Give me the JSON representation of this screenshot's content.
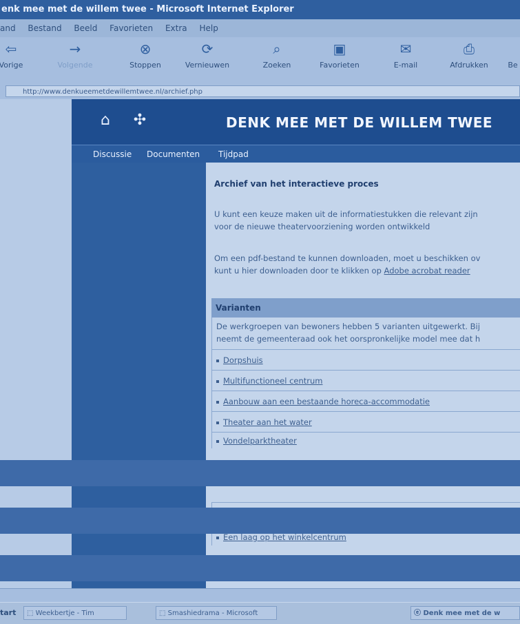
{
  "window": {
    "title": "enk mee met de willem twee - Microsoft Internet Explorer"
  },
  "menu": [
    "and",
    "Bestand",
    "Beeld",
    "Favorieten",
    "Extra",
    "Help"
  ],
  "toolbar": [
    {
      "label": "Vorige",
      "icon": "back-arrow-icon"
    },
    {
      "label": "Volgende",
      "icon": "forward-arrow-icon"
    },
    {
      "label": "Stoppen",
      "icon": "stop-icon"
    },
    {
      "label": "Vernieuwen",
      "icon": "refresh-icon"
    },
    {
      "label": "Zoeken",
      "icon": "search-icon"
    },
    {
      "label": "Favorieten",
      "icon": "favorites-icon"
    },
    {
      "label": "E-mail",
      "icon": "mail-icon"
    },
    {
      "label": "Afdrukken",
      "icon": "print-icon"
    },
    {
      "label": "Be",
      "icon": "edit-icon"
    }
  ],
  "address": {
    "url": "http://www.denkueemetdewillemtwee.nl/archief.php"
  },
  "site": {
    "title": "DENK MEE MET DE WILLEM TWEE"
  },
  "nav": [
    "Discussie",
    "Documenten",
    "Tijdpad"
  ],
  "content": {
    "heading": "Archief van het interactieve proces",
    "p1_line1": "U kunt een keuze maken uit de informatiestukken die relevant zijn",
    "p1_line2": "voor de nieuwe theatervoorziening worden ontwikkeld",
    "p2_line1": "Om een pdf-bestand te kunnen downloaden, moet u beschikken ov",
    "p2_line2_pre": "kunt u hier downloaden door te klikken op ",
    "p2_link": "Adobe acrobat reader",
    "box_title": "Varianten",
    "box_line1": "De werkgroepen van bewoners hebben 5 varianten uitgewerkt. Bij",
    "box_line2": "neemt de gemeenteraad ook het oorspronkelijke model mee dat h",
    "variants": [
      "Dorpshuis",
      "Multifunctioneel centrum",
      "Aanbouw aan een bestaande horeca-accommodatie",
      "Theater aan het water",
      "Vondelparktheater"
    ],
    "lower_items": [
      "Een laag op het winkelcentrum"
    ]
  },
  "taskbar": {
    "start": "tart",
    "items": [
      "Weekbertje - Tim",
      "Smashiedrama - Microsoft",
      "Denk mee met de w"
    ]
  }
}
